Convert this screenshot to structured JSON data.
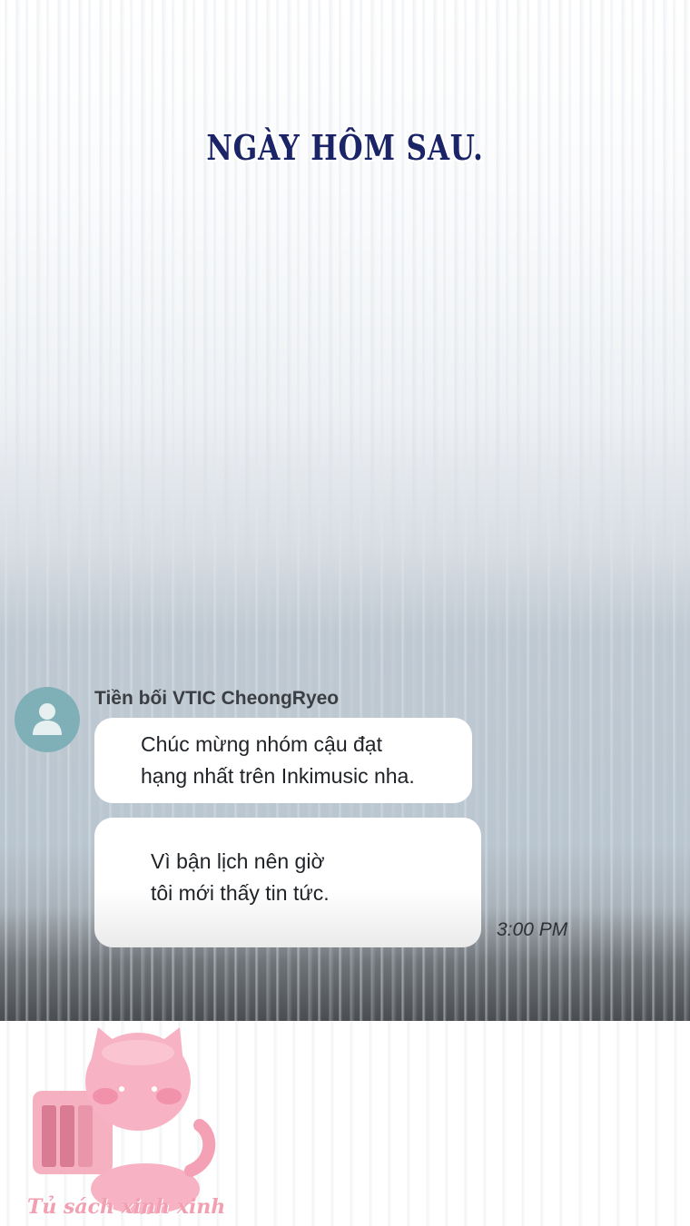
{
  "caption": "NGÀY HÔM SAU.",
  "chat": {
    "sender": "Tiền bối VTIC CheongRyeo",
    "messages": [
      {
        "line1": "Chúc mừng nhóm cậu đạt",
        "line2": "hạng nhất trên Inkimusic nha."
      },
      {
        "line1": "Vì bận lịch nên giờ",
        "line2": "tôi mới thấy tin tức."
      }
    ],
    "time": "3:00 PM"
  },
  "watermark": {
    "text": "Tủ sách xinh xinh",
    "icon": "pink-cat-books-logo"
  },
  "colors": {
    "caption": "#1a2466",
    "avatar": "#7fb0b8",
    "bubble": "#ffffff",
    "watermark": "#f29fb1"
  }
}
